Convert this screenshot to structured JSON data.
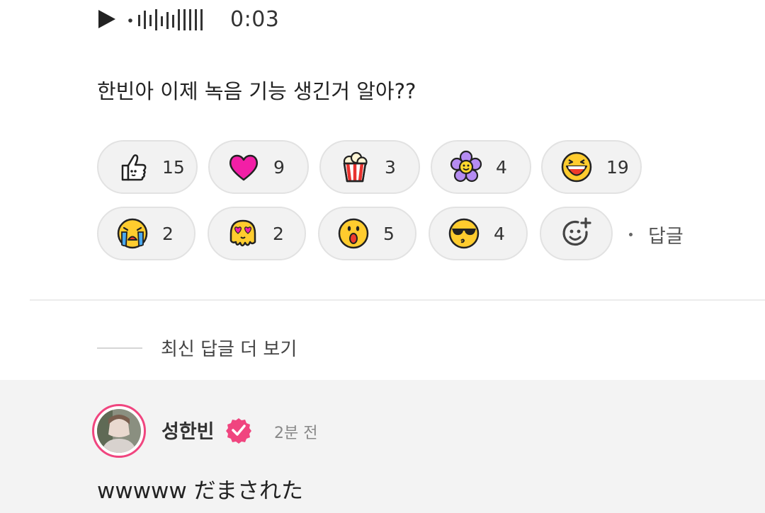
{
  "audio": {
    "duration": "0:03",
    "play_icon": "play-icon",
    "waveform_icon": "waveform-icon"
  },
  "comment": {
    "text": "한빈아 이제 녹음 기능 생긴거 알아??"
  },
  "reactions": [
    {
      "icon": "thumbs-up-icon",
      "count": "15"
    },
    {
      "icon": "heart-icon",
      "count": "9"
    },
    {
      "icon": "popcorn-icon",
      "count": "3"
    },
    {
      "icon": "flower-icon",
      "count": "4"
    },
    {
      "icon": "laughing-face-icon",
      "count": "19"
    },
    {
      "icon": "crying-face-icon",
      "count": "2"
    },
    {
      "icon": "heart-eyes-face-icon",
      "count": "2"
    },
    {
      "icon": "surprised-face-icon",
      "count": "5"
    },
    {
      "icon": "sunglasses-face-icon",
      "count": "4"
    }
  ],
  "add_reaction": {
    "icon": "add-reaction-icon"
  },
  "reply_link": {
    "label": "답글"
  },
  "more_replies": {
    "label": "최신 답글 더 보기"
  },
  "reply": {
    "author": "성한빈",
    "verified_icon": "verified-badge-icon",
    "time": "2분 전",
    "text": "wwwww だまされた"
  },
  "colors": {
    "accent": "#f0457f",
    "chip_bg": "#f2f2f2",
    "reply_bg": "#f3f3f3"
  }
}
